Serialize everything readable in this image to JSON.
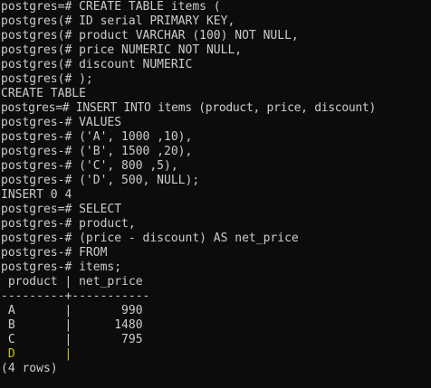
{
  "terminal": {
    "prompt_continue": "postgres(#",
    "prompt_main": "postgres=#",
    "prompt_continue_dash": "postgres-#",
    "lines": [
      "postgres=# CREATE TABLE items (",
      "postgres(# ID serial PRIMARY KEY,",
      "postgres(# product VARCHAR (100) NOT NULL,",
      "postgres(# price NUMERIC NOT NULL,",
      "postgres(# discount NUMERIC",
      "postgres(# );",
      "CREATE TABLE",
      "postgres=# INSERT INTO items (product, price, discount)",
      "postgres-# VALUES",
      "postgres-# ('A', 1000 ,10),",
      "postgres-# ('B', 1500 ,20),",
      "postgres-# ('C', 800 ,5),",
      "postgres-# ('D', 500, NULL);",
      "INSERT 0 4",
      "postgres=# SELECT",
      "postgres-# product,",
      "postgres-# (price - discount) AS net_price",
      "postgres-# FROM",
      "postgres-# items;",
      " product | net_price",
      "---------+-----------",
      " A       |       990",
      " B       |      1480",
      " C       |       795",
      " D       |",
      "(4 rows)"
    ]
  },
  "result": {
    "columns": [
      "product",
      "net_price"
    ],
    "rows": [
      {
        "product": "A",
        "net_price": "990"
      },
      {
        "product": "B",
        "net_price": "1480"
      },
      {
        "product": "C",
        "net_price": "795"
      },
      {
        "product": "D",
        "net_price": ""
      }
    ],
    "footer": "(4 rows)"
  },
  "colors": {
    "background": "#0c0c0c",
    "text": "#cccccc",
    "null_row_highlight": "#c8c800"
  }
}
